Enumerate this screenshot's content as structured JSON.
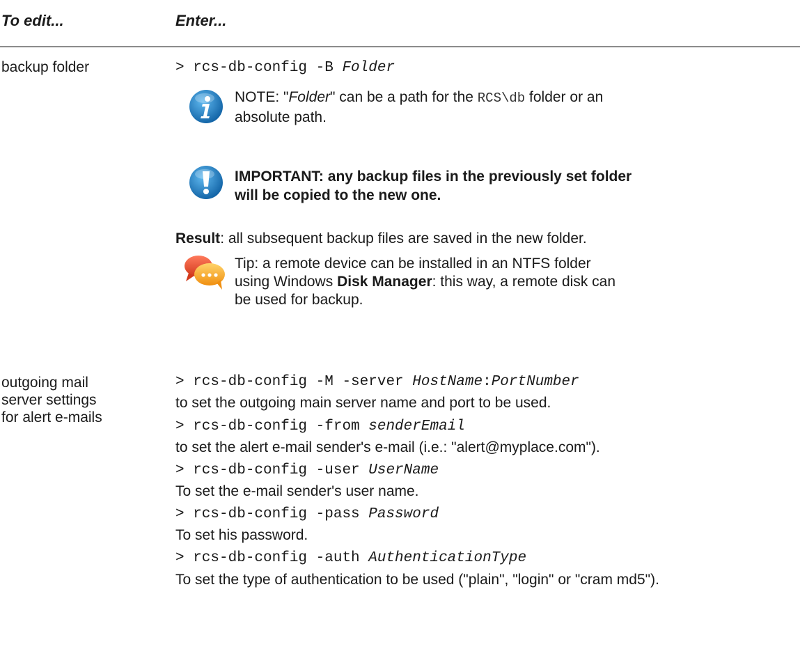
{
  "table": {
    "header": {
      "col1": "To edit...",
      "col2": "Enter..."
    },
    "row1": {
      "label": "backup folder",
      "command": {
        "prefix": "> rcs-db-config -B ",
        "arg": "Folder"
      },
      "note": {
        "prefix": "NOTE: \"",
        "folder_word": "Folder",
        "middle": "\" can be a path for the ",
        "path": "RCS\\db",
        "suffix_line1": " folder or an",
        "line2": "absolute path."
      },
      "important": {
        "line1": "IMPORTANT: any backup files in the previously set folder",
        "line2": "will be copied to the new one."
      },
      "result": {
        "label": "Result",
        "text": ": all subsequent backup files are saved in the new folder."
      },
      "tip": {
        "line1": "Tip: a remote device can be installed in an NTFS folder",
        "line2_prefix": "using Windows ",
        "line2_bold": "Disk Manager",
        "line2_suffix": ": this way, a remote disk can",
        "line3": "be used for backup."
      }
    },
    "row2": {
      "label_line1": "outgoing mail",
      "label_line2": "server settings",
      "label_line3": "for alert e-mails",
      "cmd1": {
        "prefix": "> rcs-db-config -M -server ",
        "arg1": "HostName",
        "sep": ":",
        "arg2": "PortNumber"
      },
      "desc1": "to set the outgoing main server name and port to be used.",
      "cmd2": {
        "prefix": "> rcs-db-config -from ",
        "arg": "senderEmail"
      },
      "desc2": "to set the alert e-mail sender's e-mail (i.e.: \"alert@myplace.com\").",
      "cmd3": {
        "prefix": "> rcs-db-config -user ",
        "arg": "UserName"
      },
      "desc3": "To set the e-mail sender's user name.",
      "cmd4": {
        "prefix": "> rcs-db-config -pass ",
        "arg": "Password"
      },
      "desc4": "To set his password.",
      "cmd5": {
        "prefix": "> rcs-db-config -auth ",
        "arg": "AuthenticationType"
      },
      "desc5": "To set the type of authentication to be used (\"plain\", \"login\" or \"cram md5\")."
    }
  },
  "icons": {
    "info": "info-icon",
    "important": "exclamation-icon",
    "tip": "chat-bubbles-icon"
  },
  "colors": {
    "info_blue": "#1f7fc4",
    "tip_red": "#e24a2c",
    "tip_orange": "#f4a21c",
    "rule": "#8c8c8c"
  }
}
